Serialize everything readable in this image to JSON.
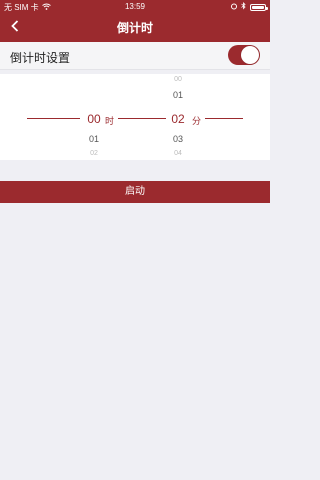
{
  "status_bar": {
    "carrier": "无 SIM 卡",
    "time": "13:59"
  },
  "nav": {
    "title": "倒计时"
  },
  "setting": {
    "label": "倒计时设置",
    "toggle_on": true
  },
  "picker": {
    "hours": {
      "prev2": "",
      "prev1": "",
      "selected": "00",
      "next1": "01",
      "next2": "02",
      "unit": "时"
    },
    "minutes": {
      "prev2": "00",
      "prev1": "01",
      "selected": "02",
      "next1": "03",
      "next2": "04",
      "unit": "分"
    }
  },
  "start_button": {
    "label": "启动"
  },
  "colors": {
    "accent": "#9b2a2e",
    "background": "#efeff4"
  },
  "icons": [
    "wifi-icon",
    "location-icon",
    "bluetooth-icon",
    "battery-icon",
    "back-chevron-icon"
  ]
}
